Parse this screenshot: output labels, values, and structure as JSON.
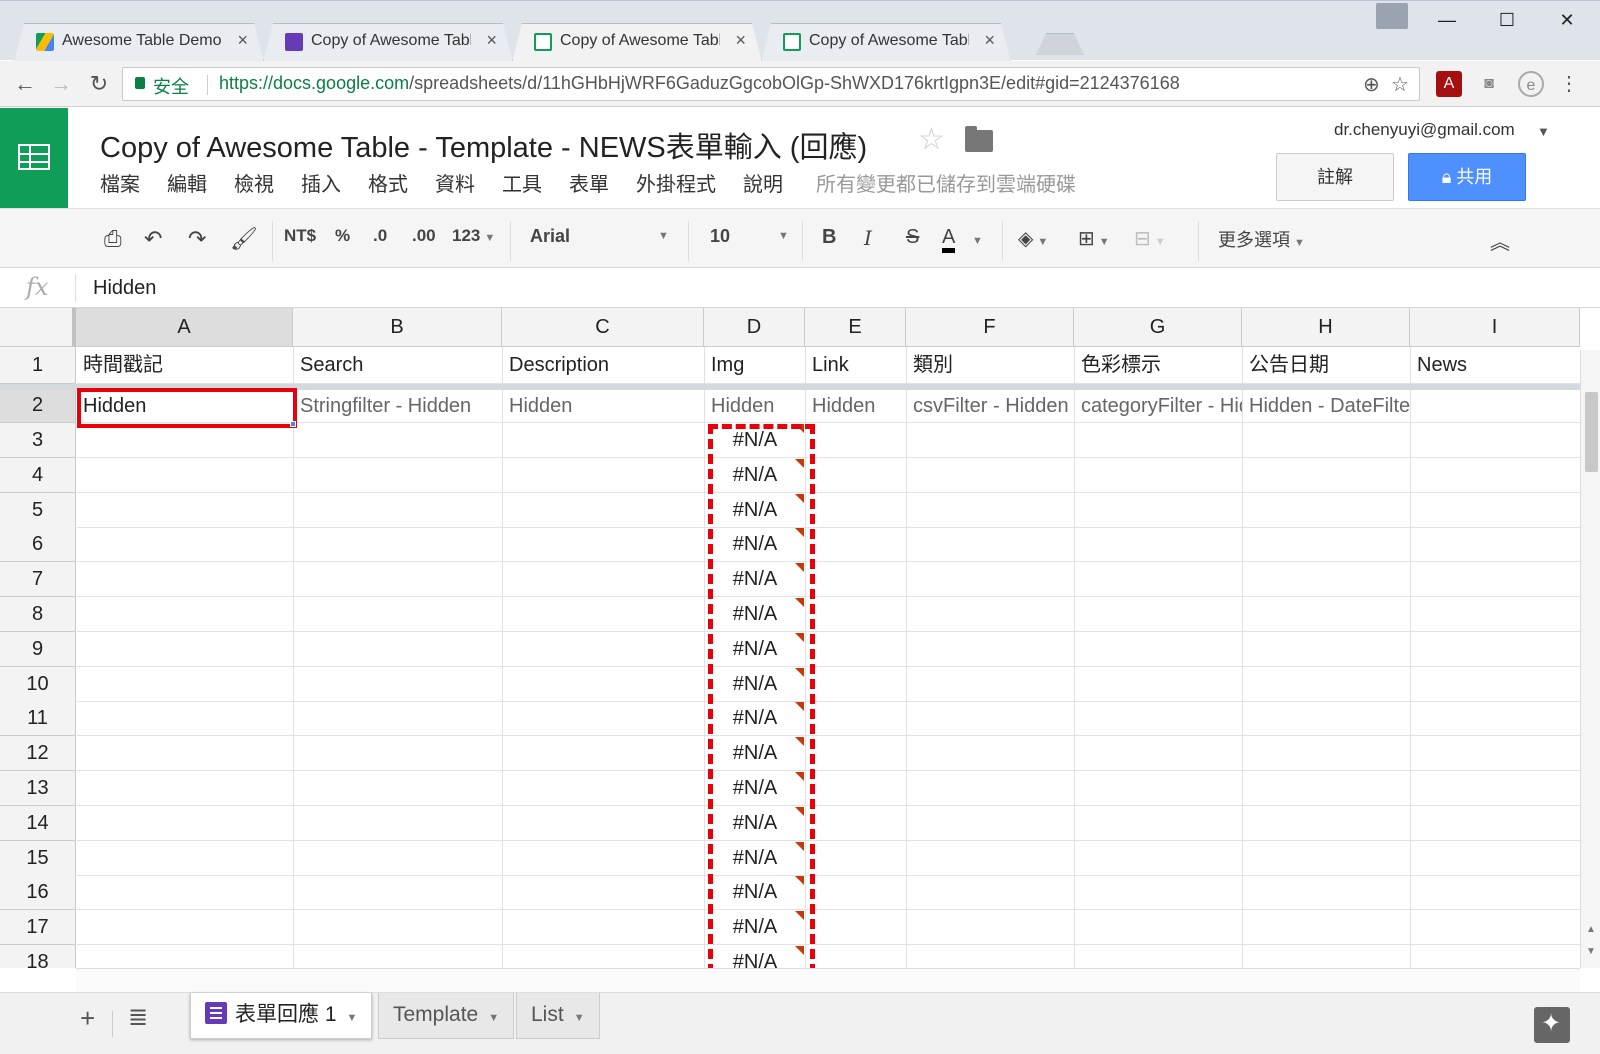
{
  "browser": {
    "tabs": [
      {
        "label": "Awesome Table Demo -",
        "icon": "drive-icon",
        "active": false
      },
      {
        "label": "Copy of Awesome Table",
        "icon": "forms-icon",
        "active": false
      },
      {
        "label": "Copy of Awesome Table",
        "icon": "sheets-icon",
        "active": true
      },
      {
        "label": "Copy of Awesome Table",
        "icon": "sheets-icon",
        "active": false
      }
    ],
    "secure_label": "安全",
    "url_host": "https://docs.google.com",
    "url_path": "/spreadsheets/d/11hGHbHjWRF6GaduzGgcobOlGp-ShWXD176krtIgpn3E/edit#gid=2124376168"
  },
  "doc": {
    "title": "Copy of Awesome Table - Template - NEWS表單輸入 (回應)",
    "menu": [
      "檔案",
      "編輯",
      "檢視",
      "插入",
      "格式",
      "資料",
      "工具",
      "表單",
      "外掛程式",
      "說明"
    ],
    "save_status": "所有變更都已儲存到雲端硬碟",
    "account": "dr.chenyuyi@gmail.com",
    "comments_label": "註解",
    "share_label": "共用"
  },
  "toolbar": {
    "currency": "NT$",
    "percent": "%",
    "dec_less": ".0",
    "dec_more": ".00",
    "format_more": "123",
    "font": "Arial",
    "font_size": "10",
    "more_options": "更多選項"
  },
  "formula": {
    "fx": "fx",
    "value": "Hidden"
  },
  "sheet": {
    "columns": [
      "A",
      "B",
      "C",
      "D",
      "E",
      "F",
      "G",
      "H",
      "I"
    ],
    "row_numbers": [
      "1",
      "2",
      "3",
      "4",
      "5",
      "6",
      "7",
      "8",
      "9",
      "10",
      "11",
      "12",
      "13",
      "14",
      "15",
      "16",
      "17",
      "18"
    ],
    "row1": [
      "時間戳記",
      "Search",
      "Description",
      "Img",
      "Link",
      "類別",
      "色彩標示",
      "公告日期",
      "News"
    ],
    "row2": [
      "Hidden",
      "Stringfilter - Hidden",
      "Hidden",
      "Hidden",
      "Hidden",
      "csvFilter - Hidden",
      "categoryFilter - Hidden",
      "Hidden - DateFilter",
      ""
    ],
    "error_value": "#N/A",
    "selected_cell": "A2"
  },
  "sheet_tabs": [
    {
      "label": "表單回應 1",
      "active": true
    },
    {
      "label": "Template",
      "active": false
    },
    {
      "label": "List",
      "active": false
    }
  ],
  "colors": {
    "sheets_green": "#0f9d58",
    "share_blue": "#4d90fe",
    "highlight_red": "#e8000b",
    "forms_purple": "#673ab7"
  }
}
